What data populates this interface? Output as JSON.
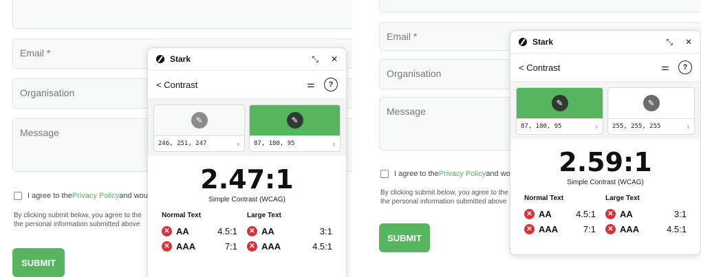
{
  "left": {
    "form": {
      "email_label": "Email *",
      "organisation_label": "Organisation",
      "message_label": "Message",
      "consent_prefix": "I agree to the ",
      "consent_link": "Privacy Policy",
      "consent_suffix": " and would",
      "fine_print_1": "By clicking submit below, you agree to the",
      "fine_print_2": "the personal information submitted above",
      "submit_label": "SUBMIT"
    },
    "stark": {
      "title": "Stark",
      "back_label": "< Contrast",
      "foreground": {
        "value": "246, 251, 247",
        "color": "#f6fbf7"
      },
      "background": {
        "value": "87, 180, 95",
        "color": "#57b45f"
      },
      "ratio": "2.47:1",
      "ratio_caption": "Simple Contrast (WCAG)",
      "normal_text": {
        "header": "Normal Text",
        "rows": [
          {
            "level": "AA",
            "required": "4.5:1"
          },
          {
            "level": "AAA",
            "required": "7:1"
          }
        ]
      },
      "large_text": {
        "header": "Large Text",
        "rows": [
          {
            "level": "AA",
            "required": "3:1"
          },
          {
            "level": "AAA",
            "required": "4.5:1"
          }
        ]
      }
    }
  },
  "right": {
    "form": {
      "email_label": "Email *",
      "organisation_label": "Organisation",
      "message_label": "Message",
      "consent_prefix": "I agree to the ",
      "consent_link": "Privacy Policy",
      "consent_suffix": " and would",
      "fine_print_1": "By clicking submit below, you agree to the",
      "fine_print_2": "the personal information submitted above",
      "submit_label": "SUBMIT"
    },
    "stark": {
      "title": "Stark",
      "back_label": "< Contrast",
      "foreground": {
        "value": "87, 180, 95",
        "color": "#57b45f"
      },
      "background": {
        "value": "255, 255, 255",
        "color": "#ffffff"
      },
      "ratio": "2.59:1",
      "ratio_caption": "Simple Contrast (WCAG)",
      "normal_text": {
        "header": "Normal Text",
        "rows": [
          {
            "level": "AA",
            "required": "4.5:1"
          },
          {
            "level": "AAA",
            "required": "7:1"
          }
        ]
      },
      "large_text": {
        "header": "Large Text",
        "rows": [
          {
            "level": "AA",
            "required": "3:1"
          },
          {
            "level": "AAA",
            "required": "4.5:1"
          }
        ]
      }
    }
  },
  "icons": {
    "minimize": "minimize-icon",
    "close": "close-icon",
    "settings": "sliders-icon",
    "help": "help-icon",
    "eyedropper": "eyedropper-icon",
    "fail": "fail-icon"
  },
  "colors": {
    "accent": "#57b45f",
    "fail": "#d6343b"
  }
}
